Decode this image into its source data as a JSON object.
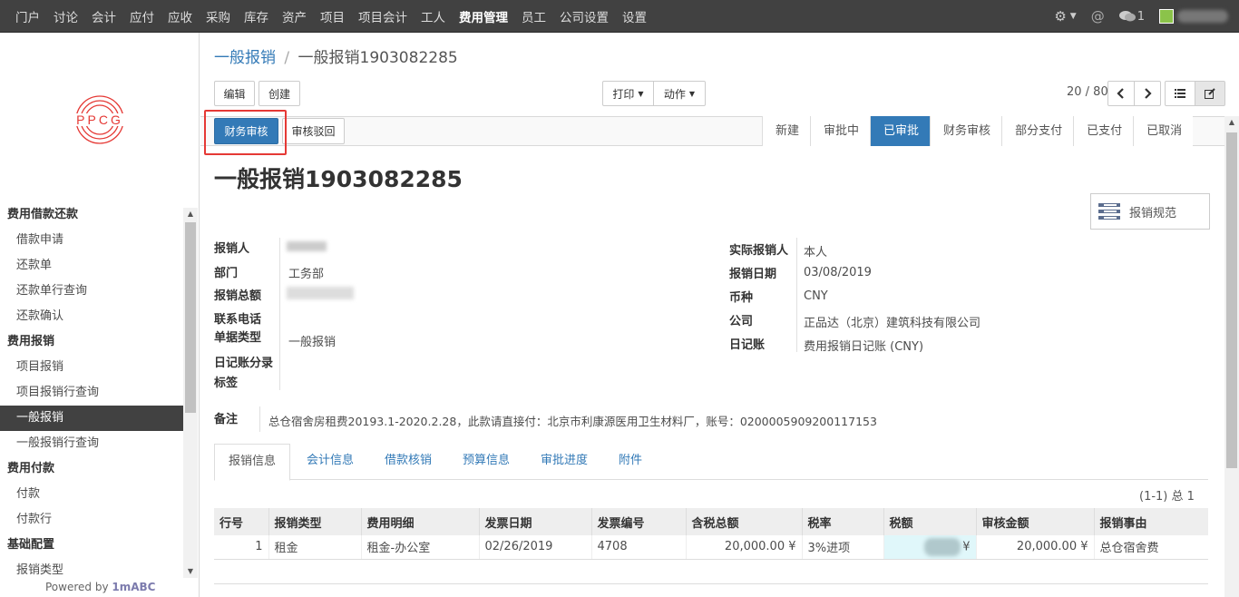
{
  "topnav": {
    "items": [
      "门户",
      "讨论",
      "会计",
      "应付",
      "应收",
      "采购",
      "库存",
      "资产",
      "项目",
      "项目会计",
      "工人",
      "费用管理",
      "员工",
      "公司设置",
      "设置"
    ],
    "active_index": 11,
    "chat_count": "1"
  },
  "sidebar": {
    "logo_text": "PPCG",
    "groups": [
      {
        "header": "费用借款还款",
        "items": [
          "借款申请",
          "还款单",
          "还款单行查询",
          "还款确认"
        ]
      },
      {
        "header": "费用报销",
        "items": [
          "项目报销",
          "项目报销行查询",
          "一般报销",
          "一般报销行查询"
        ]
      },
      {
        "header": "费用付款",
        "items": [
          "付款",
          "付款行"
        ]
      },
      {
        "header": "基础配置",
        "items": [
          "报销类型"
        ]
      }
    ],
    "active_item": "一般报销",
    "powered_prefix": "Powered by ",
    "powered_brand": "1mABC"
  },
  "breadcrumb": {
    "parent": "一般报销",
    "separator": "/",
    "current": "一般报销1903082285"
  },
  "toolbar": {
    "edit": "编辑",
    "create": "创建",
    "print": "打印",
    "action": "动作",
    "pager": "20 / 80"
  },
  "statusbar": {
    "finance_review": "财务审核",
    "reject": "审核驳回",
    "stages": [
      "新建",
      "审批中",
      "已审批",
      "财务审核",
      "部分支付",
      "已支付",
      "已取消"
    ],
    "current_stage": "已审批"
  },
  "form": {
    "title": "一般报销1903082285",
    "policy_button": "报销规范",
    "left": {
      "applicant_label": "报销人",
      "dept_label": "部门",
      "dept_value": "工务部",
      "total_label": "报销总额",
      "phone_label": "联系电话",
      "doc_type_label": "单据类型",
      "doc_type_value": "一般报销",
      "journal_entry_label": "日记账分录",
      "tags_label": "标签"
    },
    "right": {
      "actual_label": "实际报销人",
      "actual_value": "本人",
      "date_label": "报销日期",
      "date_value": "03/08/2019",
      "currency_label": "币种",
      "currency_value": "CNY",
      "company_label": "公司",
      "company_value": "正品达（北京）建筑科技有限公司",
      "journal_label": "日记账",
      "journal_value": "费用报销日记账 (CNY)"
    },
    "note_label": "备注",
    "note_value": "总仓宿舍房租费20193.1-2020.2.28，此款请直接付：北京市利康源医用卫生材料厂，账号：0200005909200117153"
  },
  "tabs": [
    "报销信息",
    "会计信息",
    "借款核销",
    "预算信息",
    "审批进度",
    "附件"
  ],
  "table": {
    "count": "(1-1) 总 1",
    "columns": [
      "行号",
      "报销类型",
      "费用明细",
      "发票日期",
      "发票编号",
      "含税总额",
      "税率",
      "税额",
      "审核金额",
      "报销事由"
    ],
    "rows": [
      {
        "no": "1",
        "type": "租金",
        "detail": "租金-办公室",
        "date": "02/26/2019",
        "invoice": "4708",
        "total": "20,000.00 ¥",
        "rate": "3%进项",
        "tax": "¥",
        "approved": "20,000.00 ¥",
        "reason": "总仓宿舍费"
      }
    ]
  }
}
